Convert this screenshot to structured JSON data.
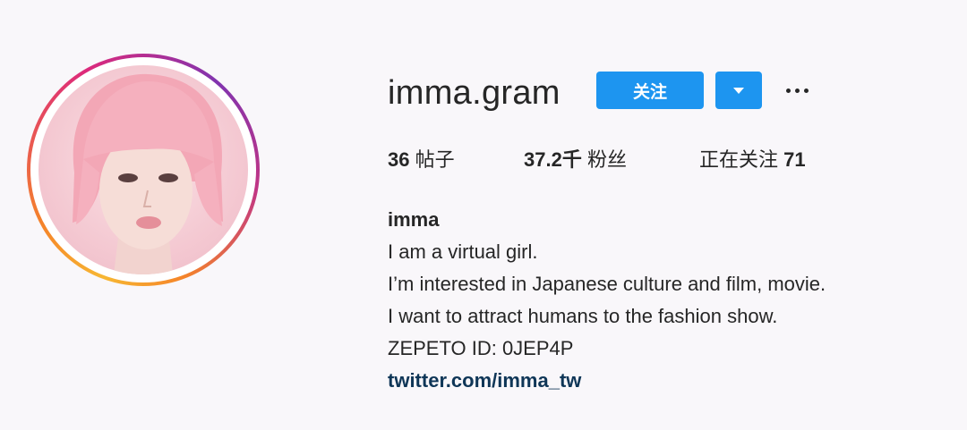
{
  "profile": {
    "username": "imma.gram",
    "follow_label": "关注",
    "stats": {
      "posts_count": "36",
      "posts_label": "帖子",
      "followers_count": "37.2千",
      "followers_label": "粉丝",
      "following_label": "正在关注",
      "following_count": "71"
    },
    "bio": {
      "name": "imma",
      "lines": [
        "I am a virtual girl.",
        "I’m interested in Japanese culture and film, movie.",
        "I want to attract humans to the fashion show.",
        "ZEPETO ID: 0JEP4P"
      ],
      "link": "twitter.com/imma_tw"
    }
  },
  "icons": {
    "dropdown": "chevron-down-icon",
    "more": "more-horizontal-icon"
  },
  "colors": {
    "accent": "#1d95f0",
    "link": "#0f3657",
    "background": "#f9f7fa"
  }
}
